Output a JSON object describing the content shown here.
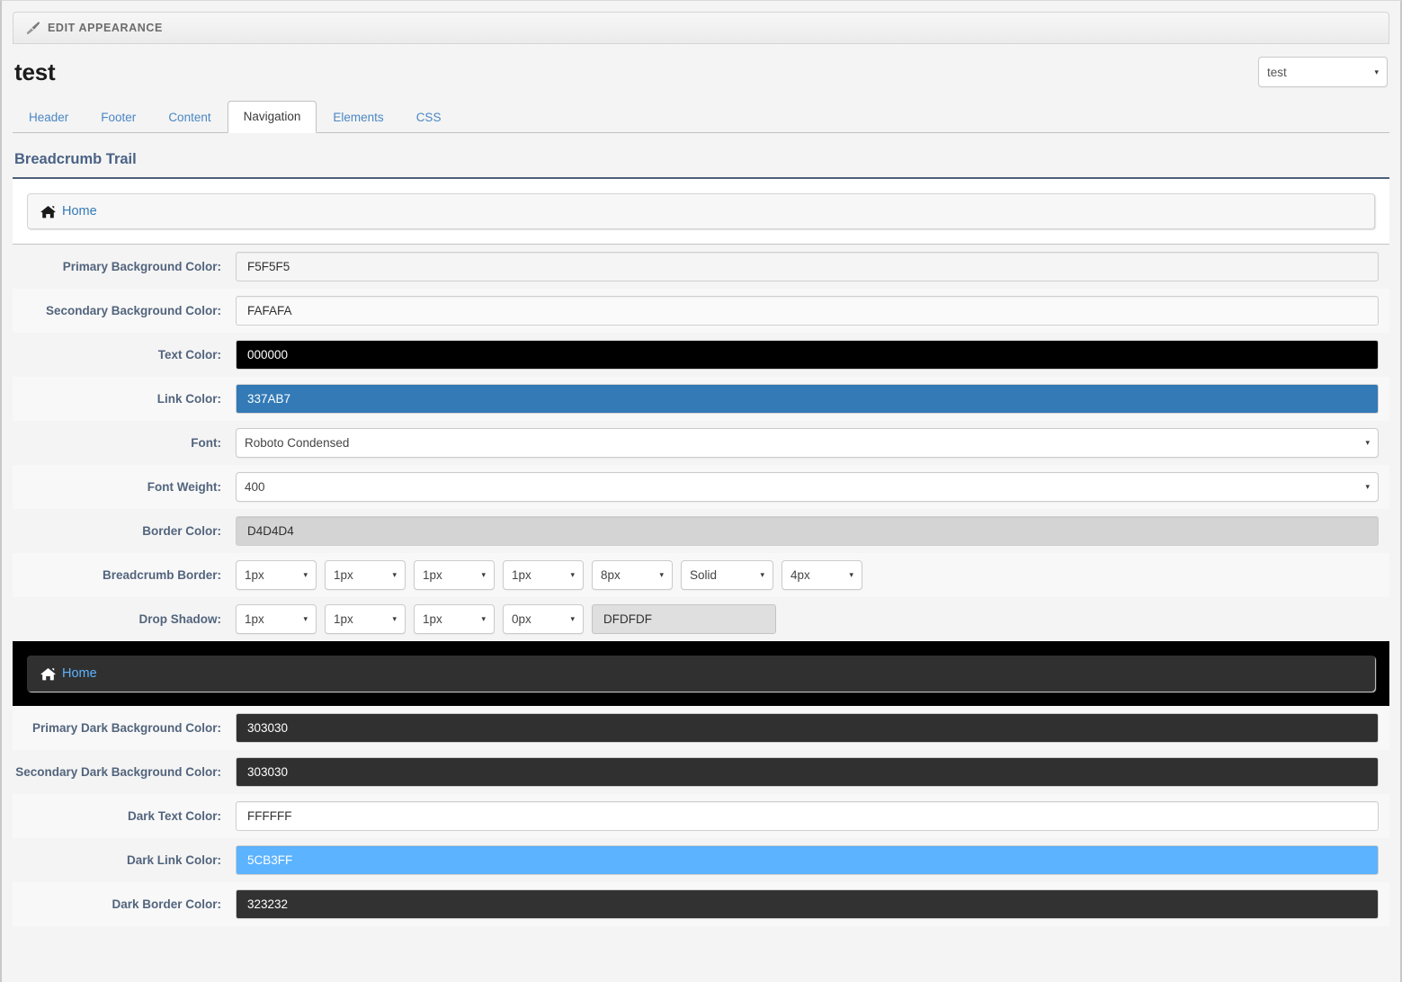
{
  "panel": {
    "header_label": "EDIT APPEARANCE",
    "header_icon": "paintbrush-icon"
  },
  "page": {
    "title": "test"
  },
  "site_selector": {
    "value": "test",
    "caret": "▾"
  },
  "tabs": [
    {
      "label": "Header",
      "active": false
    },
    {
      "label": "Footer",
      "active": false
    },
    {
      "label": "Content",
      "active": false
    },
    {
      "label": "Navigation",
      "active": true
    },
    {
      "label": "Elements",
      "active": false
    },
    {
      "label": "CSS",
      "active": false
    }
  ],
  "section": {
    "heading": "Breadcrumb Trail"
  },
  "preview_light": {
    "crumb_label": "Home",
    "crumb_icon": "home-icon",
    "box_bg": "#F5F5F5",
    "link_color": "#337AB7",
    "border_color": "#D4D4D4",
    "shadow_color": "#DFDFDF"
  },
  "preview_dark": {
    "crumb_label": "Home",
    "crumb_icon": "home-icon",
    "outer_bg": "#000000",
    "box_bg": "#303030",
    "link_color": "#5CB3FF",
    "border_color": "#323232"
  },
  "fields": {
    "primary_bg": {
      "label": "Primary Background Color:",
      "value": "F5F5F5",
      "bg": "#F5F5F5",
      "fg": "#303030"
    },
    "secondary_bg": {
      "label": "Secondary Background Color:",
      "value": "FAFAFA",
      "bg": "#FAFAFA",
      "fg": "#303030"
    },
    "text_color": {
      "label": "Text Color:",
      "value": "000000",
      "bg": "#000000",
      "fg": "#FFFFFF"
    },
    "link_color": {
      "label": "Link Color:",
      "value": "337AB7",
      "bg": "#337AB7",
      "fg": "#FFFFFF"
    },
    "font": {
      "label": "Font:",
      "value": "Roboto Condensed"
    },
    "font_weight": {
      "label": "Font Weight:",
      "value": "400"
    },
    "border_color": {
      "label": "Border Color:",
      "value": "D4D4D4",
      "bg": "#D4D4D4",
      "fg": "#303030"
    },
    "breadcrumb_border": {
      "label": "Breadcrumb Border:",
      "parts": [
        "1px",
        "1px",
        "1px",
        "1px",
        "8px",
        "Solid",
        "4px"
      ]
    },
    "drop_shadow": {
      "label": "Drop Shadow:",
      "parts": [
        "1px",
        "1px",
        "1px",
        "0px"
      ],
      "color_value": "DFDFDF",
      "color_bg": "#DFDFDF",
      "color_fg": "#303030"
    },
    "primary_dark_bg": {
      "label": "Primary Dark Background Color:",
      "value": "303030",
      "bg": "#303030",
      "fg": "#FFFFFF"
    },
    "secondary_dark_bg": {
      "label": "Secondary Dark Background Color:",
      "value": "303030",
      "bg": "#303030",
      "fg": "#FFFFFF"
    },
    "dark_text_color": {
      "label": "Dark Text Color:",
      "value": "FFFFFF",
      "bg": "#FFFFFF",
      "fg": "#303030"
    },
    "dark_link_color": {
      "label": "Dark Link Color:",
      "value": "5CB3FF",
      "bg": "#5CB3FF",
      "fg": "#FFFFFF"
    },
    "dark_border_color": {
      "label": "Dark Border Color:",
      "value": "323232",
      "bg": "#323232",
      "fg": "#FFFFFF"
    }
  },
  "icons": {
    "caret_down": "▾"
  }
}
